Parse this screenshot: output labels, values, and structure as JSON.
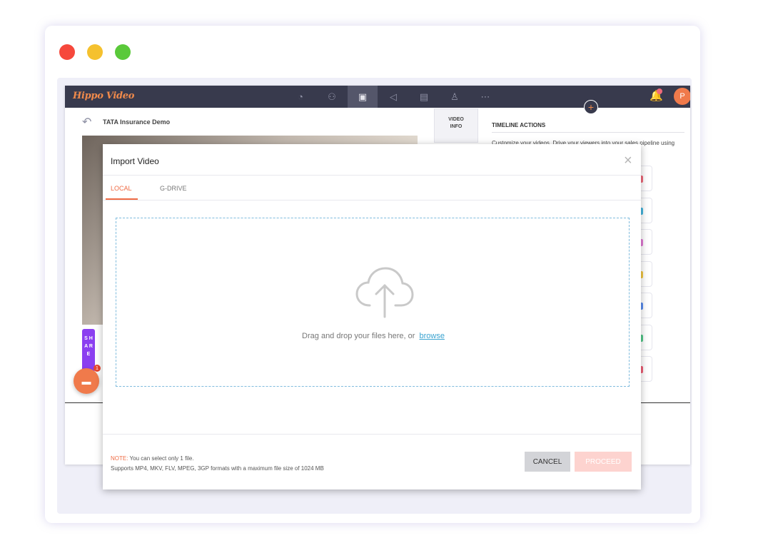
{
  "window": {
    "controls": [
      "close",
      "minimize",
      "maximize"
    ]
  },
  "app": {
    "logo": "Hippo Video",
    "nav_icons": [
      "dashboard-icon",
      "contacts-icon",
      "video-icon",
      "campaign-icon",
      "document-icon",
      "user-icon",
      "more-icon"
    ],
    "avatar_initial": "P",
    "video_title": "TATA Insurance Demo",
    "share_label": "S H A R E",
    "side_tab_label_1": "VIDEO",
    "side_tab_label_2": "INFO",
    "timeline_heading": "TIMELINE ACTIONS",
    "timeline_description": "Customize your videos. Drive your viewers into your sales pipeline using",
    "chat_badge": "1",
    "action_colors": [
      "#f06a7a",
      "#46b7e0",
      "#e27ad5",
      "#f2c744",
      "#5a8ef0",
      "#54c98b",
      "#ef5f76"
    ]
  },
  "modal": {
    "title": "Import Video",
    "close_symbol": "×",
    "tabs": [
      {
        "label": "LOCAL",
        "active": true
      },
      {
        "label": "G-DRIVE",
        "active": false
      }
    ],
    "drop_text": "Drag and drop your files here, or",
    "browse_link": "browse",
    "note_label": "NOTE:",
    "note_text": "You can select only 1 file.",
    "formats_text": "Supports MP4, MKV, FLV, MPEG, 3GP formats with a maximum file size of 1024 MB",
    "cancel_label": "CANCEL",
    "proceed_label": "PROCEED"
  },
  "colors": {
    "accent": "#ef6b44",
    "topbar": "#383a4d",
    "link": "#3aa3d0",
    "share": "#8b3ff0"
  }
}
